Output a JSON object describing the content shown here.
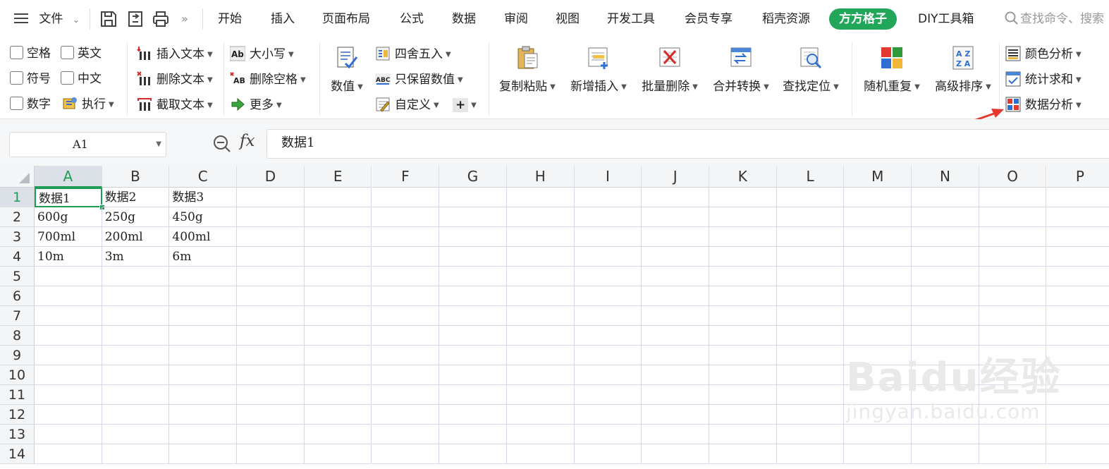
{
  "menubar": {
    "file_label": "文件",
    "tabs": [
      "开始",
      "插入",
      "页面布局",
      "公式",
      "数据",
      "审阅",
      "视图",
      "开发工具",
      "会员专享",
      "稻壳资源"
    ],
    "active_tab": "方方格子",
    "diy_tab": "DIY工具箱",
    "search_placeholder": "查找命令、搜索"
  },
  "ribbon": {
    "checkboxes": [
      "空格",
      "英文",
      "符号",
      "中文",
      "数字"
    ],
    "execute_label": "执行",
    "text_tools": [
      "插入文本",
      "删除文本",
      "截取文本"
    ],
    "case_tools": [
      "大小写",
      "删除空格",
      "更多"
    ],
    "numeric_label": "数值",
    "number_tools": [
      "四舍五入",
      "只保留数值",
      "自定义"
    ],
    "big_buttons": [
      "复制粘贴",
      "新增插入",
      "批量删除",
      "合并转换",
      "查找定位"
    ],
    "random_label": "随机重复",
    "sort_label": "高级排序",
    "analysis_tools": [
      "颜色分析",
      "统计求和",
      "数据分析"
    ]
  },
  "formula_bar": {
    "cell_ref": "A1",
    "fx_label": "fx",
    "content": "数据1"
  },
  "sheet": {
    "columns": [
      "A",
      "B",
      "C",
      "D",
      "E",
      "F",
      "G",
      "H",
      "I",
      "J",
      "K",
      "L",
      "M",
      "N",
      "O",
      "P"
    ],
    "rows": [
      "1",
      "2",
      "3",
      "4",
      "5",
      "6",
      "7",
      "8",
      "9",
      "10",
      "11",
      "12",
      "13",
      "14"
    ],
    "cells": [
      [
        "数据1",
        "数据2",
        "数据3"
      ],
      [
        "600g",
        "250g",
        "450g"
      ],
      [
        "700ml",
        "200ml",
        "400ml"
      ],
      [
        "10m",
        "3m",
        "6m"
      ]
    ],
    "active_cell": "A1"
  },
  "watermark": {
    "logo": "Baidu经验",
    "url": "jingyan.baidu.com"
  },
  "colors": {
    "accent": "#22a65a",
    "annotation_arrow": "#e8372b"
  }
}
